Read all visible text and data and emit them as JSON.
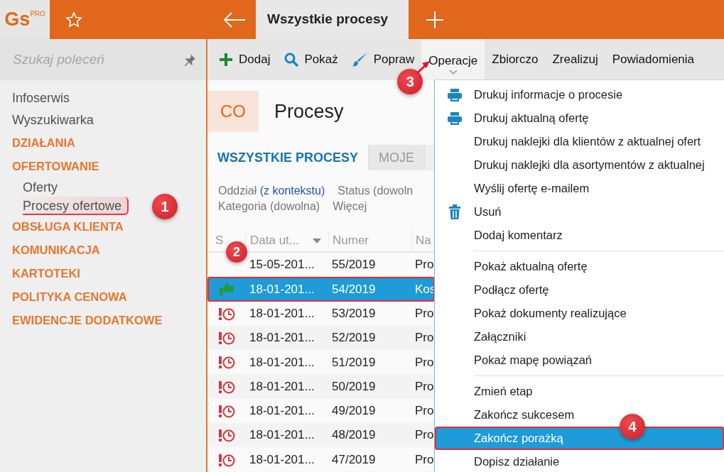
{
  "app": {
    "logo": "Gs",
    "logo_badge": "PRO"
  },
  "header": {
    "tab_title": "Wszystkie procesy"
  },
  "search": {
    "placeholder": "Szukaj poleceń"
  },
  "sidebar": {
    "items": [
      {
        "kind": "link",
        "label": "Infoserwis"
      },
      {
        "kind": "link",
        "label": "Wyszukiwarka"
      },
      {
        "kind": "group",
        "label": "DZIAŁANIA"
      },
      {
        "kind": "group",
        "label": "OFERTOWANIE",
        "children": [
          {
            "label": "Oferty",
            "highlighted": false
          },
          {
            "label": "Procesy ofertowe",
            "highlighted": true,
            "callout": "1"
          }
        ]
      },
      {
        "kind": "group",
        "label": "OBSŁUGA KLIENTA"
      },
      {
        "kind": "group",
        "label": "KOMUNIKACJA"
      },
      {
        "kind": "group",
        "label": "KARTOTEKI"
      },
      {
        "kind": "group",
        "label": "POLITYKA CENOWA"
      },
      {
        "kind": "group",
        "label": "EWIDENCJE DODATKOWE"
      }
    ]
  },
  "toolbar": [
    {
      "label": "Dodaj",
      "kind": "add",
      "open": false
    },
    {
      "label": "Pokaż",
      "kind": "show",
      "open": false
    },
    {
      "label": "Popraw",
      "kind": "edit",
      "open": false
    },
    {
      "label": "Operacje",
      "kind": "menu",
      "open": true,
      "callout": "3"
    },
    {
      "label": "Zbiorczo",
      "kind": "menu",
      "open": false
    },
    {
      "label": "Zrealizuj",
      "kind": "menu",
      "open": false
    },
    {
      "label": "Powiadomienia",
      "kind": "menu",
      "open": false
    }
  ],
  "module": {
    "badge": "CO",
    "title": "Procesy"
  },
  "tabs": [
    {
      "label": "WSZYSTKIE PROCESY",
      "selected": true
    },
    {
      "label": "MOJE",
      "selected": false
    }
  ],
  "filters": [
    [
      {
        "label": "Oddział",
        "value": "(z kontekstu)"
      },
      {
        "label": "Status (dowoln"
      }
    ],
    [
      {
        "label": "Kategoria (dowolna)"
      },
      {
        "label": "Więcej"
      }
    ]
  ],
  "table": {
    "columns": [
      {
        "label": "S",
        "sorted": false
      },
      {
        "label": "Data ut...",
        "sorted": true
      },
      {
        "label": "Numer",
        "sorted": false
      },
      {
        "label": "Na",
        "sorted": false
      }
    ],
    "rows": [
      {
        "kind": "plain",
        "date": "15-05-201...",
        "number": "55/2019",
        "name": "Pro",
        "selected": false
      },
      {
        "kind": "won",
        "date": "18-01-201...",
        "number": "54/2019",
        "name": "Kos",
        "selected": true,
        "callout": "2"
      },
      {
        "kind": "overdue",
        "date": "18-01-201...",
        "number": "53/2019",
        "name": "Pro",
        "selected": false
      },
      {
        "kind": "overdue",
        "date": "18-01-201...",
        "number": "52/2019",
        "name": "Pro",
        "selected": false
      },
      {
        "kind": "overdue",
        "date": "18-01-201...",
        "number": "51/2019",
        "name": "Pro",
        "selected": false
      },
      {
        "kind": "overdue",
        "date": "18-01-201...",
        "number": "50/2019",
        "name": "Pro",
        "selected": false
      },
      {
        "kind": "overdue",
        "date": "18-01-201...",
        "number": "49/2019",
        "name": "Pro",
        "selected": false
      },
      {
        "kind": "overdue",
        "date": "18-01-201...",
        "number": "48/2019",
        "name": "Pro",
        "selected": false
      },
      {
        "kind": "overdue",
        "date": "18-01-201...",
        "number": "47/2019",
        "name": "Pro",
        "selected": false
      }
    ]
  },
  "menu": [
    {
      "kind": "print",
      "label": "Drukuj informacje o procesie",
      "highlighted": false
    },
    {
      "kind": "print",
      "label": "Drukuj aktualną ofertę",
      "highlighted": false
    },
    {
      "kind": "item",
      "label": "Drukuj naklejki dla klientów z aktualnej ofert",
      "highlighted": false
    },
    {
      "kind": "item",
      "label": "Drukuj naklejki dla asortymentów z aktualnej",
      "highlighted": false
    },
    {
      "kind": "item",
      "label": "Wyślij ofertę e-mailem",
      "highlighted": false
    },
    {
      "kind": "delete",
      "label": "Usuń",
      "highlighted": false
    },
    {
      "kind": "item",
      "label": "Dodaj komentarz",
      "highlighted": false
    },
    {
      "kind": "separator"
    },
    {
      "kind": "item",
      "label": "Pokaż aktualną ofertę",
      "highlighted": false
    },
    {
      "kind": "item",
      "label": "Podłącz ofertę",
      "highlighted": false
    },
    {
      "kind": "item",
      "label": "Pokaż dokumenty realizujące",
      "highlighted": false
    },
    {
      "kind": "item",
      "label": "Załączniki",
      "highlighted": false
    },
    {
      "kind": "item",
      "label": "Pokaż mapę powiązań",
      "highlighted": false
    },
    {
      "kind": "separator"
    },
    {
      "kind": "item",
      "label": "Zmień etap",
      "highlighted": false
    },
    {
      "kind": "item",
      "label": "Zakończ sukcesem",
      "highlighted": false
    },
    {
      "kind": "item",
      "label": "Zakończ porażką",
      "highlighted": true,
      "callout": "4"
    },
    {
      "kind": "item",
      "label": "Dopisz działanie",
      "highlighted": false
    }
  ]
}
